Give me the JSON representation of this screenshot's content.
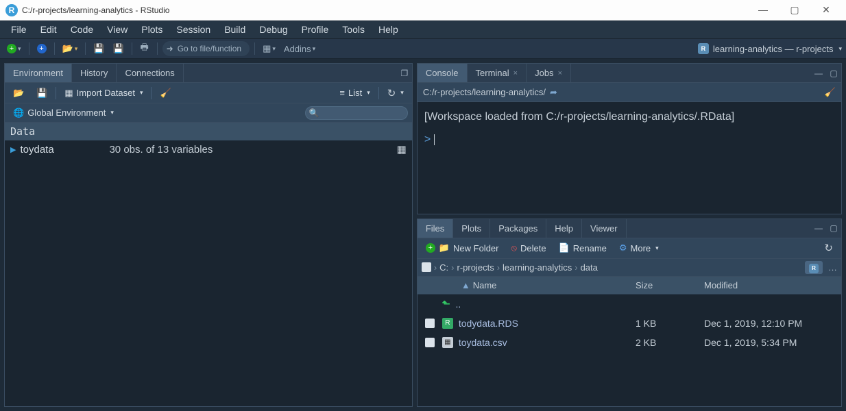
{
  "window": {
    "title": "C:/r-projects/learning-analytics - RStudio"
  },
  "menu": [
    "File",
    "Edit",
    "Code",
    "View",
    "Plots",
    "Session",
    "Build",
    "Debug",
    "Profile",
    "Tools",
    "Help"
  ],
  "toolbar": {
    "goto_placeholder": "Go to file/function",
    "addins": "Addins",
    "project": "learning-analytics — r-projects"
  },
  "env": {
    "tabs": [
      "Environment",
      "History",
      "Connections"
    ],
    "import": "Import Dataset",
    "list": "List",
    "scope": "Global Environment",
    "section": "Data",
    "items": [
      {
        "name": "toydata",
        "desc": "30 obs. of 13 variables"
      }
    ]
  },
  "console": {
    "tabs": [
      "Console",
      "Terminal",
      "Jobs"
    ],
    "path": "C:/r-projects/learning-analytics/",
    "text": "[Workspace loaded from C:/r-projects/learning-analytics/.RData]",
    "prompt": ">"
  },
  "files": {
    "tabs": [
      "Files",
      "Plots",
      "Packages",
      "Help",
      "Viewer"
    ],
    "buttons": {
      "newfolder": "New Folder",
      "delete": "Delete",
      "rename": "Rename",
      "more": "More"
    },
    "breadcrumb": [
      "C:",
      "r-projects",
      "learning-analytics",
      "data"
    ],
    "cols": {
      "name": "Name",
      "size": "Size",
      "modified": "Modified"
    },
    "up": "..",
    "rows": [
      {
        "icon": "rds",
        "name": "todydata.RDS",
        "size": "1 KB",
        "modified": "Dec 1, 2019, 12:10 PM"
      },
      {
        "icon": "csv",
        "name": "toydata.csv",
        "size": "2 KB",
        "modified": "Dec 1, 2019, 5:34 PM"
      }
    ]
  }
}
